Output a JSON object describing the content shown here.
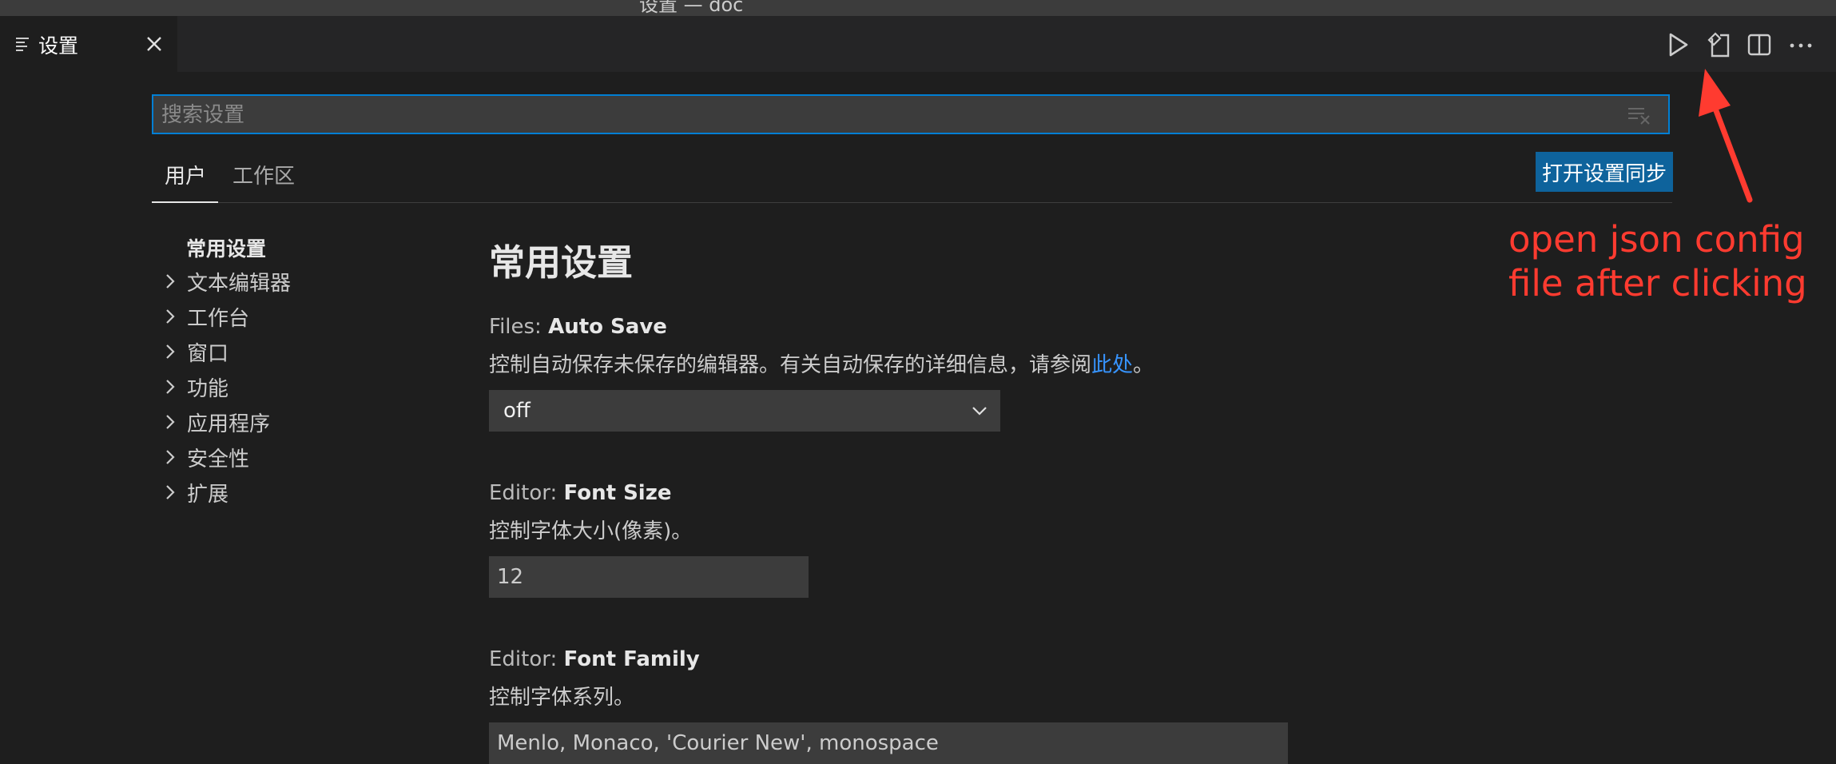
{
  "window": {
    "title": "设置 — doc"
  },
  "tab": {
    "label": "设置",
    "icon": "settings-editor-icon"
  },
  "editor_actions": [
    {
      "name": "run-icon"
    },
    {
      "name": "open-settings-json-icon"
    },
    {
      "name": "split-editor-icon"
    },
    {
      "name": "more-actions-icon"
    }
  ],
  "search": {
    "placeholder": "搜索设置",
    "value": ""
  },
  "scope_tabs": [
    {
      "label": "用户",
      "active": true
    },
    {
      "label": "工作区",
      "active": false
    }
  ],
  "sync_button": {
    "label": "打开设置同步"
  },
  "toc": {
    "heading": "常用设置",
    "items": [
      "文本编辑器",
      "工作台",
      "窗口",
      "功能",
      "应用程序",
      "安全性",
      "扩展"
    ]
  },
  "section": {
    "title": "常用设置"
  },
  "settings": {
    "auto_save": {
      "category": "Files: ",
      "name": "Auto Save",
      "description": "控制自动保存未保存的编辑器。有关自动保存的详细信息，请参阅",
      "link": "此处",
      "suffix": "。",
      "value": "off"
    },
    "font_size": {
      "category": "Editor: ",
      "name": "Font Size",
      "description": "控制字体大小(像素)。",
      "value": "12"
    },
    "font_family": {
      "category": "Editor: ",
      "name": "Font Family",
      "description": "控制字体系列。",
      "value": "Menlo, Monaco, 'Courier New', monospace"
    }
  },
  "annotation": {
    "line1": "open json config",
    "line2": "file after clicking",
    "color": "#ff3b30"
  },
  "colors": {
    "background": "#1e1e1e",
    "accent": "#007fd4",
    "button": "#0e639c",
    "link": "#3794ff"
  }
}
